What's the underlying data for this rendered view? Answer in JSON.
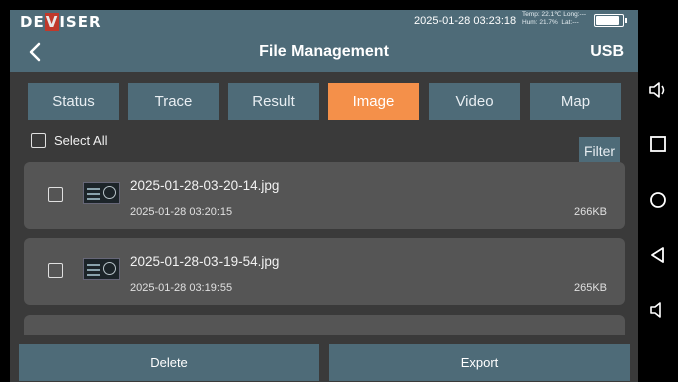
{
  "status_bar": {
    "logo": "DEVISER",
    "logo_parts": [
      "DE",
      "V",
      "ISER"
    ],
    "datetime": "2025-01-28 03:23:18",
    "temp": "Temp:  22.1℃",
    "long": "Long:---",
    "hum": "Hum:  21.7%",
    "lat": "Lat:---",
    "battery_level": 0.92
  },
  "header": {
    "title": "File Management",
    "storage": "USB"
  },
  "tabs": [
    {
      "label": "Status",
      "active": false
    },
    {
      "label": "Trace",
      "active": false
    },
    {
      "label": "Result",
      "active": false
    },
    {
      "label": "Image",
      "active": true
    },
    {
      "label": "Video",
      "active": false
    },
    {
      "label": "Map",
      "active": false
    }
  ],
  "toolbar": {
    "select_all_label": "Select All",
    "filter_label": "Filter"
  },
  "files": [
    {
      "name": "2025-01-28-03-20-14.jpg",
      "date": "2025-01-28 03:20:15",
      "size": "266KB"
    },
    {
      "name": "2025-01-28-03-19-54.jpg",
      "date": "2025-01-28 03:19:55",
      "size": "265KB"
    }
  ],
  "actions": {
    "delete_label": "Delete",
    "export_label": "Export"
  },
  "colors": {
    "header": "#4e6b78",
    "active_tab": "#f4904a",
    "background": "#3a3a3a",
    "list_item": "#555555"
  },
  "nav_icons": [
    "volume-up-icon",
    "recent-apps-icon",
    "home-icon",
    "back-nav-icon",
    "volume-down-icon"
  ]
}
